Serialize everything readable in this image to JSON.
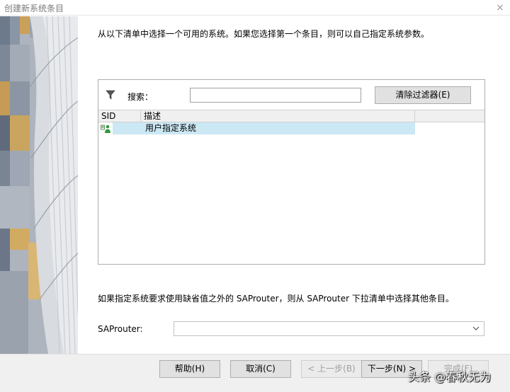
{
  "window": {
    "title": "创建新系统条目",
    "close_glyph": "×"
  },
  "intro_text": "从以下清单中选择一个可用的系统。如果您选择第一个条目，则可以自己指定系统参数。",
  "filter": {
    "icon": "funnel-icon",
    "search_label": "搜索：",
    "search_value": "",
    "clear_button": "清除过滤器(E)"
  },
  "grid": {
    "columns": [
      "SID",
      "描述"
    ],
    "rows": [
      {
        "sid": "",
        "icon": "user-system-icon",
        "description": "用户指定系统",
        "selected": true
      }
    ]
  },
  "router_note": "如果指定系统要求使用缺省值之外的 SAProuter，则从 SAProuter 下拉清单中选择其他条目。",
  "saprouter": {
    "label": "SAProuter:",
    "value": "",
    "icon": "chevron-down-icon"
  },
  "footer": {
    "help": "帮助(H)",
    "cancel": "取消(C)",
    "back": "< 上一步(B)",
    "next": "下一步(N) >",
    "finish": "完成(F)"
  },
  "watermark": "头条 @春秋无为",
  "colors": {
    "selection": "#cce8f4",
    "footer_bg": "#f0f0f0",
    "button_bg": "#e1e1e1"
  }
}
